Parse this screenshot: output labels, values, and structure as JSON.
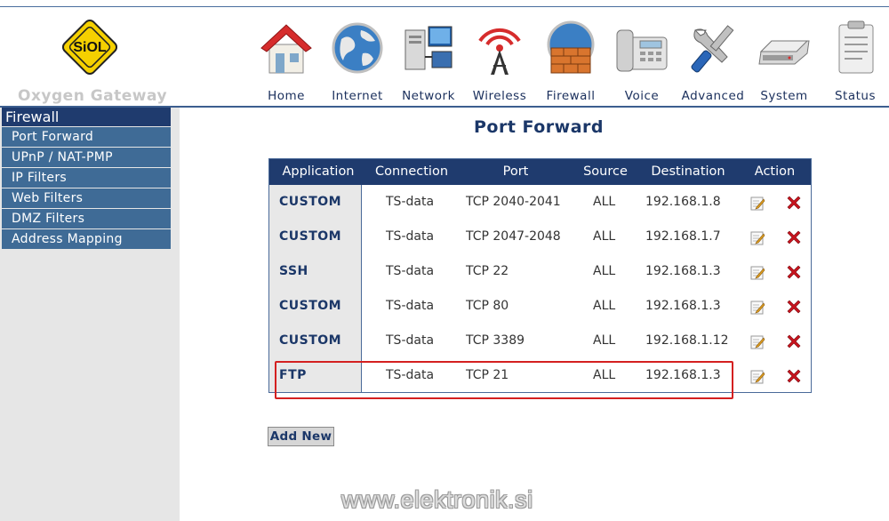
{
  "header": {
    "brand": "Oxygen Gateway",
    "logo_text": "SiOL",
    "nav": [
      {
        "label": "Home",
        "icon": "home-icon"
      },
      {
        "label": "Internet",
        "icon": "globe-icon"
      },
      {
        "label": "Network",
        "icon": "network-icon"
      },
      {
        "label": "Wireless",
        "icon": "wireless-icon"
      },
      {
        "label": "Firewall",
        "icon": "firewall-icon"
      },
      {
        "label": "Voice",
        "icon": "phone-icon"
      },
      {
        "label": "Advanced",
        "icon": "tools-icon"
      },
      {
        "label": "System",
        "icon": "router-icon"
      },
      {
        "label": "Status",
        "icon": "clipboard-icon"
      }
    ]
  },
  "sidebar": {
    "title": "Firewall",
    "items": [
      "Port Forward",
      "UPnP / NAT-PMP",
      "IP Filters",
      "Web Filters",
      "DMZ Filters",
      "Address Mapping"
    ]
  },
  "main": {
    "title": "Port Forward",
    "columns": [
      "Application",
      "Connection",
      "Port",
      "Source",
      "Destination",
      "Action"
    ],
    "rows": [
      {
        "application": "CUSTOM",
        "connection": "TS-data",
        "port": "TCP 2040-2041",
        "source": "ALL",
        "destination": "192.168.1.8"
      },
      {
        "application": "CUSTOM",
        "connection": "TS-data",
        "port": "TCP 2047-2048",
        "source": "ALL",
        "destination": "192.168.1.7"
      },
      {
        "application": "SSH",
        "connection": "TS-data",
        "port": "TCP 22",
        "source": "ALL",
        "destination": "192.168.1.3"
      },
      {
        "application": "CUSTOM",
        "connection": "TS-data",
        "port": "TCP 80",
        "source": "ALL",
        "destination": "192.168.1.3"
      },
      {
        "application": "CUSTOM",
        "connection": "TS-data",
        "port": "TCP 3389",
        "source": "ALL",
        "destination": "192.168.1.12"
      },
      {
        "application": "FTP",
        "connection": "TS-data",
        "port": "TCP 21",
        "source": "ALL",
        "destination": "192.168.1.3"
      }
    ],
    "add_new_label": "Add New"
  },
  "watermark": "www.elektronik.si",
  "colors": {
    "header_navy": "#1f3b6e",
    "sidebar_item": "#3f6b96",
    "highlight_red": "#d42020",
    "delete_red": "#c8141e"
  }
}
